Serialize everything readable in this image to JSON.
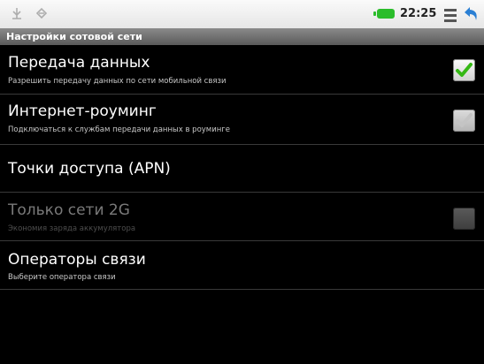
{
  "status_bar": {
    "time": "22:25",
    "battery_color": "#2bbd2b"
  },
  "header": {
    "title": "Настройки сотовой сети"
  },
  "settings": [
    {
      "title": "Передача данных",
      "summary": "Разрешить передачу данных по сети мобильной связи",
      "checkbox": true,
      "checked": true,
      "enabled": true
    },
    {
      "title": "Интернет-роуминг",
      "summary": "Подключаться к службам передачи данных в роуминге",
      "checkbox": true,
      "checked": true,
      "enabled": true
    },
    {
      "title": "Точки доступа (APN)",
      "checkbox": false
    },
    {
      "title": "Только сети 2G",
      "summary": "Экономия заряда аккумулятора",
      "checkbox": true,
      "checked": false,
      "enabled": false
    },
    {
      "title": "Операторы связи",
      "summary": "Выберите оператора связи",
      "checkbox": false
    }
  ],
  "colors": {
    "check_green": "#35b815",
    "check_grey": "#cfcfcf"
  }
}
